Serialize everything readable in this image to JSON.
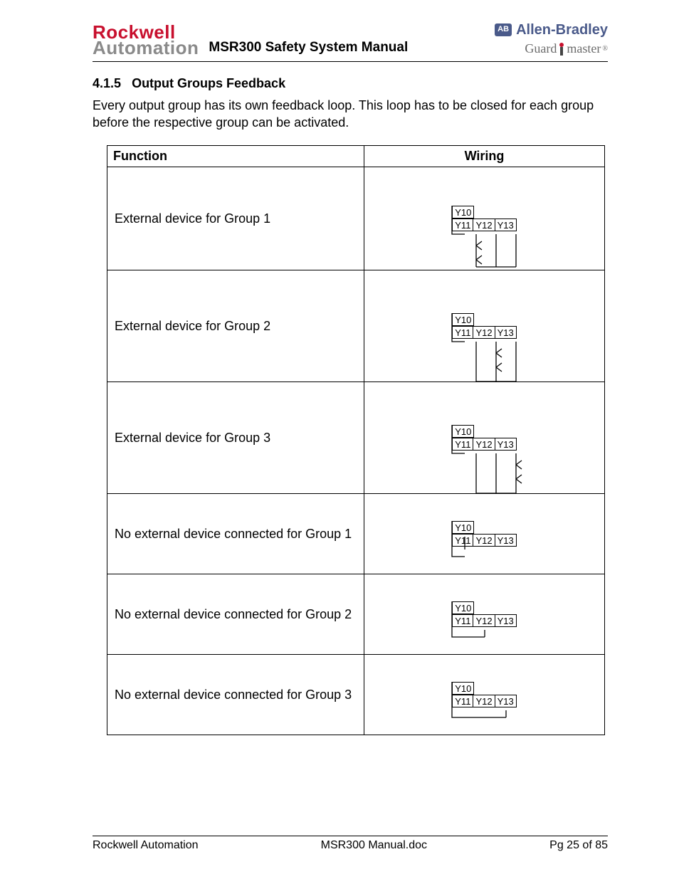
{
  "header": {
    "logo_line1": "Rockwell",
    "logo_line2": "Automation",
    "manual_title": "MSR300 Safety System Manual",
    "ab_badge": "AB",
    "ab_text": "Allen-Bradley",
    "gm_left": "Guard",
    "gm_right": "master"
  },
  "section": {
    "number": "4.1.5",
    "title": "Output Groups Feedback",
    "paragraph": "Every output group has its own feedback loop. This loop has to be closed for each group before the respective group can be activated."
  },
  "table": {
    "col_function": "Function",
    "col_wiring": "Wiring",
    "rows": [
      {
        "function": "External device for Group 1"
      },
      {
        "function": "External device for Group 2"
      },
      {
        "function": "External device for Group 3"
      },
      {
        "function": "No external device connected for Group 1"
      },
      {
        "function": "No external device connected for Group 2"
      },
      {
        "function": "No external device connected for Group 3"
      }
    ],
    "terminals": {
      "t0": "Y10",
      "t1": "Y11",
      "t2": "Y12",
      "t3": "Y13"
    }
  },
  "footer": {
    "left": "Rockwell Automation",
    "center": "MSR300 Manual.doc",
    "right": "Pg 25 of 85"
  }
}
